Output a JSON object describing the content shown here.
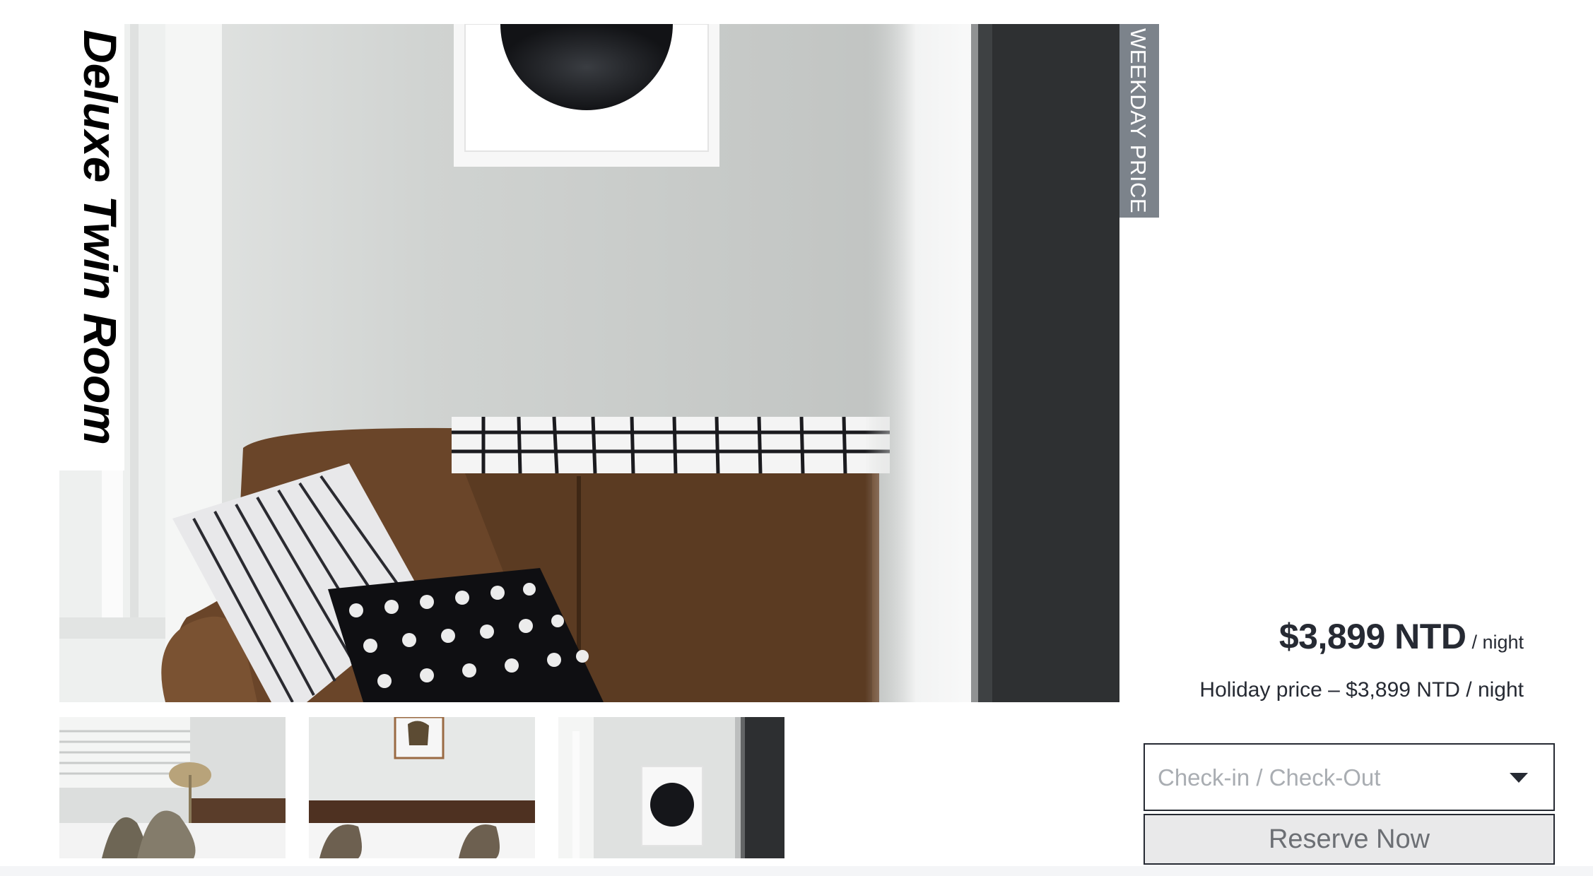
{
  "room": {
    "title": "Deluxe Twin Room",
    "weekday_tag": "WEEKDAY PRICE"
  },
  "pricing": {
    "weekday_amount": "$3,899 NTD",
    "weekday_unit": "/ night",
    "holiday_line": "Holiday price – $3,899 NTD / night"
  },
  "booking": {
    "date_placeholder": "Check-in / Check-Out",
    "reserve_label": "Reserve Now"
  },
  "gallery": {
    "main_image": "living room with brown sofa, cushions and framed moon art",
    "thumbnails": [
      "bedroom with lamp",
      "bedroom with framed art",
      "wall with moon art"
    ]
  },
  "colors": {
    "text": "#262a33",
    "tag_bg": "#7c838b",
    "button_bg": "#e9e9ea",
    "placeholder": "#a9adb2"
  }
}
